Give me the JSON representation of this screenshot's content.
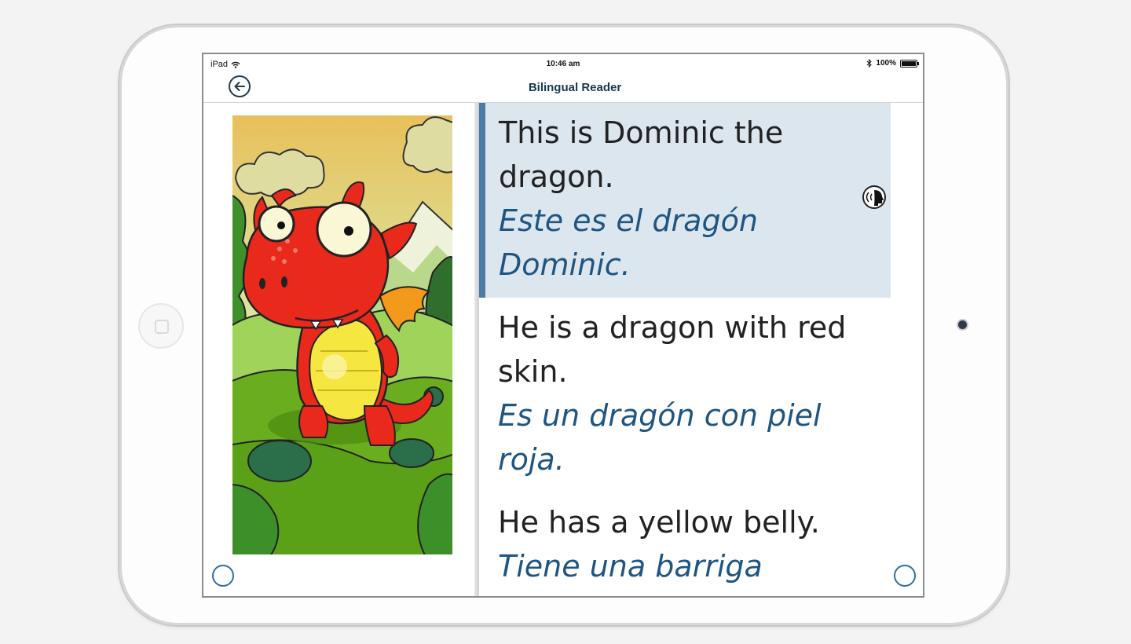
{
  "status_bar": {
    "device": "iPad",
    "time": "10:46 am",
    "battery": "100%",
    "icons": [
      "wifi-icon",
      "bluetooth-icon",
      "battery-icon"
    ]
  },
  "nav": {
    "title": "Bilingual Reader",
    "back_icon": "arrow-left-icon"
  },
  "sentences": [
    {
      "en": "This is Dominic the dragon.",
      "es": "Este es el dragón Dominic.",
      "active": true
    },
    {
      "en": "He is a dragon with red skin.",
      "es": "Es un dragón con piel roja.",
      "active": false
    },
    {
      "en": "He has a yellow belly.",
      "es": "Tiene una barriga",
      "active": false
    }
  ],
  "colors": {
    "title": "#16394f",
    "active_bg": "#dce6ef",
    "active_bar": "#4c7ba6",
    "spanish_text": "#1f5581",
    "page_circle": "#2d6fa6"
  }
}
